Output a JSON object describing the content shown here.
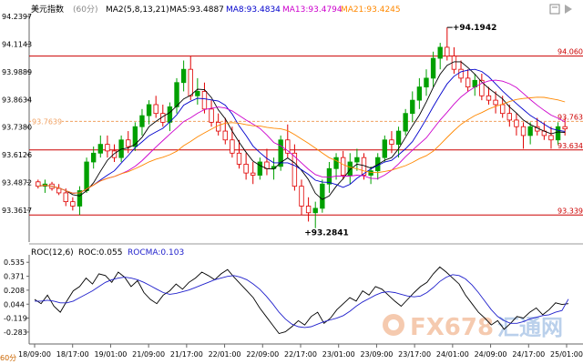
{
  "header": {
    "symbol": "美元指数",
    "period": "(60分)",
    "ma2_label": "MA2(5,8,13,21)",
    "ma5": "MA5:93.4887",
    "ma8": "MA8:93.4834",
    "ma13": "MA13:93.4794",
    "ma21": "MA21:93.4245"
  },
  "roc_header": {
    "roc_label": "ROC(12,6)",
    "roc_value": "ROC:0.055",
    "rocma_value": "ROCMA:0.103"
  },
  "side_labels": {
    "bottom_left": "60分"
  },
  "watermark": {
    "brand": "FX678",
    "cn": "汇通网"
  },
  "colors": {
    "up": "#00a000",
    "down": "#e00000",
    "ma5": "#000000",
    "ma8": "#0000cc",
    "ma13": "#cc00cc",
    "ma21": "#ff8800",
    "hline": "#cc0000",
    "dashed": "#f0a060",
    "roc": "#000000",
    "rocma": "#2020cc"
  },
  "chart_data": [
    {
      "type": "candlestick",
      "yticks": [
        "94.2397",
        "94.1143",
        "93.9889",
        "93.8634",
        "93.7380",
        "93.6126",
        "93.4872",
        "93.3617"
      ],
      "ylim": [
        93.25,
        94.24
      ],
      "xticks": [
        "18/09:00",
        "18/17:00",
        "19/01:00",
        "21/09:00",
        "21/17:00",
        "22/01:00",
        "22/09:00",
        "22/17:00",
        "23/01:00",
        "23/09:00",
        "23/17:00",
        "24/01:00",
        "24/09:00",
        "24/17:00",
        "25/01:00"
      ],
      "high_annotation": "94.1942",
      "low_annotation": "93.2841",
      "price_lines": [
        {
          "label": "94.0601",
          "value": 94.0601
        },
        {
          "label": "93.7639",
          "value": 93.7639
        },
        {
          "label": "93.6344",
          "value": 93.6344
        },
        {
          "label": "93.3396",
          "value": 93.3396
        }
      ],
      "candles": [
        [
          93.49,
          93.5,
          93.46,
          93.47
        ],
        [
          93.47,
          93.5,
          93.44,
          93.48
        ],
        [
          93.48,
          93.49,
          93.45,
          93.46
        ],
        [
          93.46,
          93.48,
          93.43,
          93.44
        ],
        [
          93.44,
          93.46,
          93.38,
          93.4
        ],
        [
          93.4,
          93.42,
          93.36,
          93.38
        ],
        [
          93.38,
          93.47,
          93.34,
          93.45
        ],
        [
          93.45,
          93.6,
          93.44,
          93.58
        ],
        [
          93.58,
          93.65,
          93.55,
          93.62
        ],
        [
          93.62,
          93.7,
          93.6,
          93.66
        ],
        [
          93.66,
          93.7,
          93.6,
          93.63
        ],
        [
          93.63,
          93.66,
          93.58,
          93.6
        ],
        [
          93.6,
          93.7,
          93.58,
          93.68
        ],
        [
          93.68,
          93.72,
          93.62,
          93.65
        ],
        [
          93.65,
          93.76,
          93.63,
          93.74
        ],
        [
          93.74,
          93.82,
          93.7,
          93.79
        ],
        [
          93.79,
          93.86,
          93.75,
          93.84
        ],
        [
          93.84,
          93.88,
          93.78,
          93.8
        ],
        [
          93.8,
          93.84,
          93.74,
          93.76
        ],
        [
          93.76,
          93.85,
          93.72,
          93.83
        ],
        [
          93.83,
          93.96,
          93.8,
          93.94
        ],
        [
          93.94,
          94.04,
          93.9,
          94.0
        ],
        [
          94.0,
          94.06,
          93.86,
          93.88
        ],
        [
          93.88,
          93.96,
          93.84,
          93.9
        ],
        [
          93.9,
          93.94,
          93.8,
          93.82
        ],
        [
          93.82,
          93.86,
          93.74,
          93.76
        ],
        [
          93.76,
          93.8,
          93.7,
          93.72
        ],
        [
          93.72,
          93.78,
          93.66,
          93.68
        ],
        [
          93.68,
          93.74,
          93.6,
          93.62
        ],
        [
          93.62,
          93.68,
          93.55,
          93.57
        ],
        [
          93.57,
          93.62,
          93.5,
          93.53
        ],
        [
          93.53,
          93.58,
          93.48,
          93.52
        ],
        [
          93.52,
          93.6,
          93.5,
          93.58
        ],
        [
          93.58,
          93.64,
          93.52,
          93.55
        ],
        [
          93.55,
          93.6,
          93.5,
          93.56
        ],
        [
          93.56,
          93.7,
          93.54,
          93.68
        ],
        [
          93.68,
          93.75,
          93.6,
          93.62
        ],
        [
          93.62,
          93.66,
          93.45,
          93.47
        ],
        [
          93.47,
          93.5,
          93.34,
          93.38
        ],
        [
          93.38,
          93.42,
          93.31,
          93.35
        ],
        [
          93.35,
          93.4,
          93.28,
          93.37
        ],
        [
          93.37,
          93.5,
          93.35,
          93.48
        ],
        [
          93.48,
          93.58,
          93.44,
          93.55
        ],
        [
          93.55,
          93.62,
          93.5,
          93.6
        ],
        [
          93.6,
          93.63,
          93.5,
          93.52
        ],
        [
          93.52,
          93.62,
          93.48,
          93.58
        ],
        [
          93.58,
          93.64,
          93.54,
          93.6
        ],
        [
          93.6,
          93.62,
          93.5,
          93.52
        ],
        [
          93.52,
          93.56,
          93.48,
          93.54
        ],
        [
          93.54,
          93.62,
          93.5,
          93.6
        ],
        [
          93.6,
          93.7,
          93.58,
          93.68
        ],
        [
          93.68,
          93.72,
          93.62,
          93.66
        ],
        [
          93.66,
          93.74,
          93.6,
          93.72
        ],
        [
          93.72,
          93.82,
          93.7,
          93.8
        ],
        [
          93.8,
          93.9,
          93.76,
          93.86
        ],
        [
          93.86,
          93.96,
          93.82,
          93.92
        ],
        [
          93.92,
          94.0,
          93.88,
          93.96
        ],
        [
          93.96,
          94.08,
          93.92,
          94.05
        ],
        [
          94.05,
          94.12,
          94.0,
          94.1
        ],
        [
          94.1,
          94.19,
          94.04,
          94.06
        ],
        [
          94.06,
          94.1,
          93.98,
          94.0
        ],
        [
          94.0,
          94.04,
          93.94,
          93.96
        ],
        [
          93.96,
          94.0,
          93.9,
          93.92
        ],
        [
          93.92,
          93.98,
          93.88,
          93.95
        ],
        [
          93.95,
          93.98,
          93.86,
          93.88
        ],
        [
          93.88,
          93.92,
          93.84,
          93.86
        ],
        [
          93.86,
          93.9,
          93.8,
          93.84
        ],
        [
          93.84,
          93.88,
          93.78,
          93.8
        ],
        [
          93.8,
          93.84,
          93.74,
          93.77
        ],
        [
          93.77,
          93.8,
          93.7,
          93.74
        ],
        [
          93.74,
          93.76,
          93.64,
          93.7
        ],
        [
          93.7,
          93.76,
          93.66,
          93.74
        ],
        [
          93.74,
          93.78,
          93.7,
          93.72
        ],
        [
          93.72,
          93.76,
          93.68,
          93.7
        ],
        [
          93.7,
          93.74,
          93.64,
          93.68
        ],
        [
          93.68,
          93.76,
          93.66,
          93.74
        ],
        [
          93.74,
          93.78,
          93.7,
          93.73
        ]
      ]
    },
    {
      "type": "line",
      "title": "ROC(12,6)",
      "yticks": [
        "0.535",
        "0.371",
        "0.208",
        "0.044",
        "-0.119",
        "-0.283"
      ],
      "ylim": [
        -0.38,
        0.58
      ],
      "series": [
        {
          "name": "ROC",
          "values": [
            0.1,
            0.05,
            0.15,
            0.02,
            -0.05,
            0.08,
            0.2,
            0.25,
            0.35,
            0.28,
            0.4,
            0.38,
            0.3,
            0.42,
            0.36,
            0.25,
            0.32,
            0.18,
            0.1,
            0.05,
            0.15,
            0.2,
            0.28,
            0.22,
            0.3,
            0.35,
            0.42,
            0.38,
            0.33,
            0.4,
            0.45,
            0.36,
            0.28,
            0.2,
            0.12,
            0.0,
            -0.1,
            -0.2,
            -0.3,
            -0.28,
            -0.22,
            -0.15,
            -0.2,
            -0.1,
            -0.05,
            -0.18,
            -0.12,
            -0.02,
            0.05,
            0.12,
            0.08,
            0.2,
            0.15,
            0.25,
            0.22,
            0.15,
            0.08,
            0.02,
            0.1,
            0.18,
            0.25,
            0.3,
            0.4,
            0.48,
            0.42,
            0.35,
            0.28,
            0.15,
            0.05,
            -0.05,
            -0.12,
            -0.2,
            -0.15,
            -0.25,
            -0.18,
            -0.1,
            -0.12,
            -0.05,
            0.0,
            -0.08,
            -0.02,
            0.06,
            0.04,
            0.05
          ]
        },
        {
          "name": "ROCMA",
          "values": [
            0.08,
            0.08,
            0.09,
            0.08,
            0.06,
            0.06,
            0.08,
            0.12,
            0.16,
            0.2,
            0.25,
            0.3,
            0.33,
            0.35,
            0.36,
            0.35,
            0.33,
            0.3,
            0.26,
            0.22,
            0.18,
            0.16,
            0.17,
            0.19,
            0.21,
            0.24,
            0.27,
            0.3,
            0.33,
            0.35,
            0.37,
            0.38,
            0.36,
            0.33,
            0.28,
            0.22,
            0.14,
            0.05,
            -0.05,
            -0.13,
            -0.19,
            -0.22,
            -0.23,
            -0.22,
            -0.19,
            -0.16,
            -0.14,
            -0.12,
            -0.09,
            -0.04,
            0.02,
            0.07,
            0.11,
            0.15,
            0.18,
            0.19,
            0.18,
            0.16,
            0.14,
            0.13,
            0.14,
            0.18,
            0.24,
            0.31,
            0.36,
            0.39,
            0.38,
            0.34,
            0.27,
            0.18,
            0.08,
            -0.02,
            -0.1,
            -0.15,
            -0.18,
            -0.18,
            -0.16,
            -0.13,
            -0.11,
            -0.09,
            -0.08,
            -0.05,
            -0.03,
            0.103
          ]
        }
      ]
    }
  ]
}
